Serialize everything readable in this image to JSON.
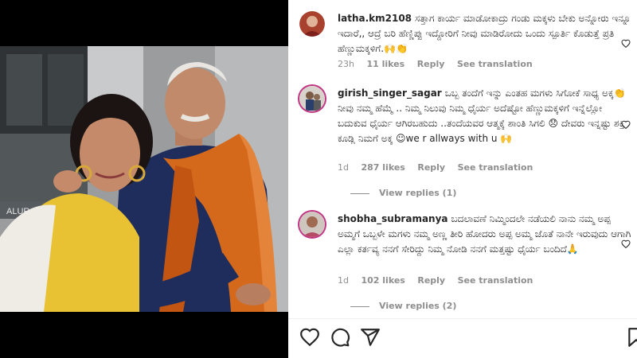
{
  "post": {
    "comments": [
      {
        "username": "latha.km2108",
        "text": "ಸತ್ತಾಗ ಕಾರ್ಯ ಮಾಡೋಕಾದ್ರು ಗಂಡು ಮಕ್ಕಳು ಬೇಕು ಅನ್ನೋರು ಇನ್ನೂ ಇದಾರೆ,, ಆದ್ರೆ ಬರಿ ಹೆಣ್ಣಿಪ್ಪು ಇದ್ದೋರಿಗೆ ನೀವು ಮಾಡಿರೋದು ಒಂದು ಸ್ಪೂರ್ತಿ ಕೊಡುತ್ತೆ ಪ್ರತಿ ಹೆಣ್ಣುಮಕ್ಕಳಿಗೆ.🙌👏",
        "time": "23h",
        "likes": "11 likes",
        "reply_label": "Reply",
        "translate_label": "See translation"
      },
      {
        "username": "girish_singer_sagar",
        "text": "ಒಬ್ಬ ತಂದೆಗೆ ಇನ್ನು ಎಂತಹ ಮಗಳು ಸಿಗೋಕೆ ಸಾಧ್ಯ ಅಕ್ಕ👏 ನೀವು ನಮ್ಮ ಹೆಮ್ಮೆ .. ನಿಮ್ಮ ನಿಲುವು ನಿಮ್ಮ ಧೈರ್ಯ ಅದೆಷ್ಟೋ ಹೆಣ್ಣುಮಕ್ಕಳಿಗೆ ಇನ್ನೆಲ್ಲೋ ಬದುಕುವ ಧೈರ್ಯ ಆಗಿರಬಹುದು ..ತಂದೆಯವರ ಆತ್ಮಕ್ಕೆ ಶಾಂತಿ ಸಿಗಲಿ 😞 ದೇವರು ಇನ್ನಷ್ಟು ಶಕ್ತಿ ಕೂಡ್ಲಿ ನಿಮಗೆ ಅಕ್ಕ ☺we r allways with u 🙌",
        "time": "1d",
        "likes": "287 likes",
        "reply_label": "Reply",
        "translate_label": "See translation",
        "view_replies": "View replies (1)"
      },
      {
        "username": "shobha_subramanya",
        "text": "ಬದಲಾವಣೆ ನಿಮ್ಮಿಂದಲೇ ನಡೆಯಲಿ ನಾನು ನಮ್ಮ ಅಪ್ಪ ಅಮ್ಮಗೆ ಒಬ್ಬಳೇ ಮಗಳು ನಮ್ಮ ಅಣ್ಣ ತೀರಿ ಹೋದರು ಅಪ್ಪ ಅಮ್ಮ ಜೊತೆ ನಾನೇ ಇರುವುದು ಆಗಾಗಿ ಎಲ್ಲಾ ಕರ್ತವ್ಯ ನನಗೆ ಸೇರಿದ್ದು ನಿಮ್ಮ ನೋಡಿ ನನಗೆ ಮತ್ತಷ್ಟು ಧೈರ್ಯ ಬಂದಿದೆ🙏",
        "time": "1d",
        "likes": "102 likes",
        "reply_label": "Reply",
        "translate_label": "See translation",
        "view_replies": "View replies (2)"
      }
    ],
    "photo_sign_text": "ALUR",
    "actions": {
      "like_icon": "heart-icon",
      "comment_icon": "comment-bubble-icon",
      "share_icon": "paper-plane-icon",
      "save_icon": "bookmark-icon"
    },
    "colors": {
      "text": "#262626",
      "meta": "#8e8e8e",
      "saree_orange": "#d4691c",
      "kurta_navy": "#1f2d5c",
      "top_yellow": "#e8c232"
    }
  }
}
